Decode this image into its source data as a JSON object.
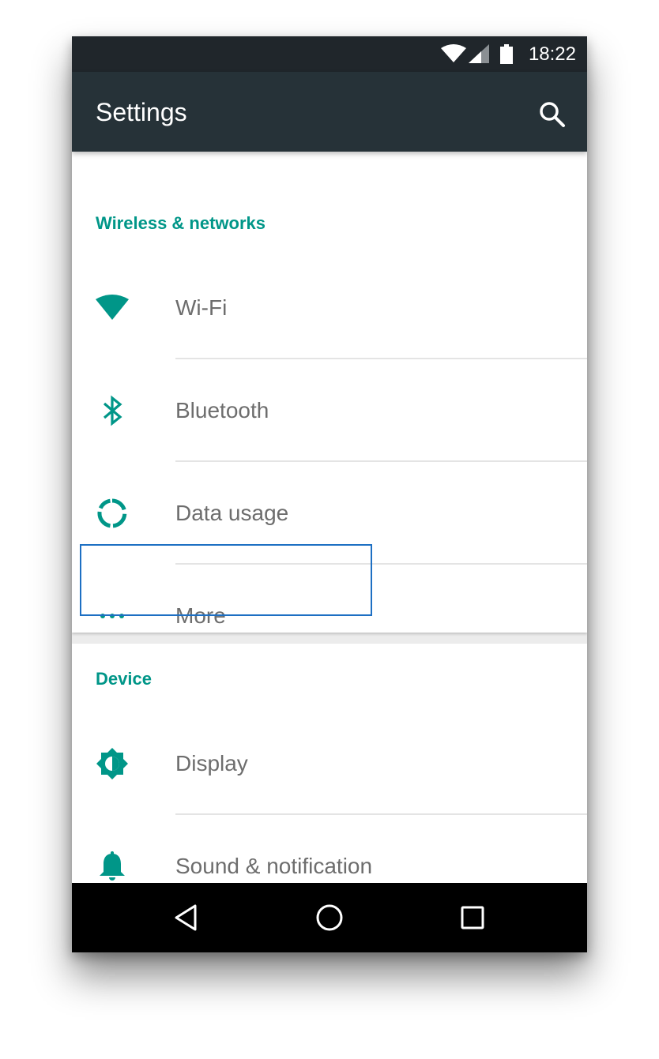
{
  "status_bar": {
    "time": "18:22",
    "icons": [
      "wifi-signal-icon",
      "cell-signal-icon",
      "battery-icon"
    ]
  },
  "app_bar": {
    "title": "Settings",
    "search_icon": "search-icon"
  },
  "sections": [
    {
      "header": "Wireless & networks",
      "items": [
        {
          "label": "Wi-Fi",
          "icon": "wifi-icon"
        },
        {
          "label": "Bluetooth",
          "icon": "bluetooth-icon"
        },
        {
          "label": "Data usage",
          "icon": "data-usage-icon"
        },
        {
          "label": "More",
          "icon": "more-horizontal-icon"
        }
      ]
    },
    {
      "header": "Device",
      "items": [
        {
          "label": "Display",
          "icon": "brightness-icon"
        },
        {
          "label": "Sound & notification",
          "icon": "bell-icon"
        }
      ]
    }
  ],
  "nav_bar": {
    "icons": [
      "back-icon",
      "home-icon",
      "recents-icon"
    ]
  },
  "colors": {
    "accent": "#009688",
    "app_bar": "#263238",
    "status_bar": "#20262b",
    "highlight": "#1d6fc3",
    "label_text": "#6d6d6d"
  }
}
